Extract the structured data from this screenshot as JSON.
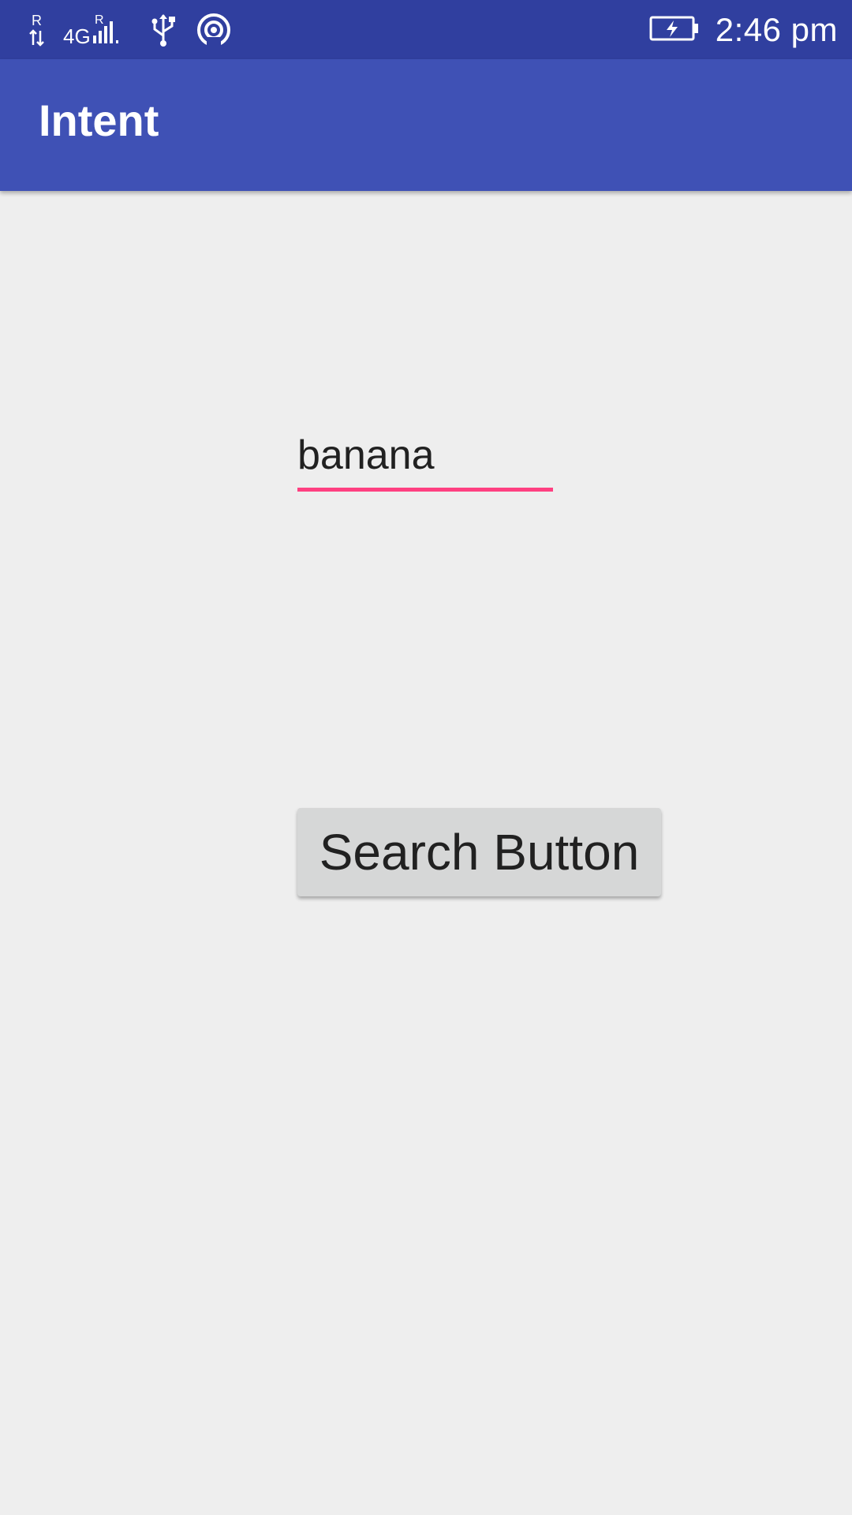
{
  "status_bar": {
    "time": "2:46 pm",
    "icons": [
      "roaming-data-icon",
      "signal-4g-icon",
      "usb-icon",
      "hotspot-icon",
      "battery-charging-icon"
    ],
    "network_label": "4G",
    "roaming_label": "R",
    "background_color": "#303f9f"
  },
  "app_bar": {
    "title": "Intent",
    "background_color": "#3f51b5"
  },
  "main": {
    "search_input": {
      "value": "banana",
      "underline_color": "#ff4081"
    },
    "search_button": {
      "label": "Search Button",
      "background_color": "#d6d7d7"
    }
  }
}
